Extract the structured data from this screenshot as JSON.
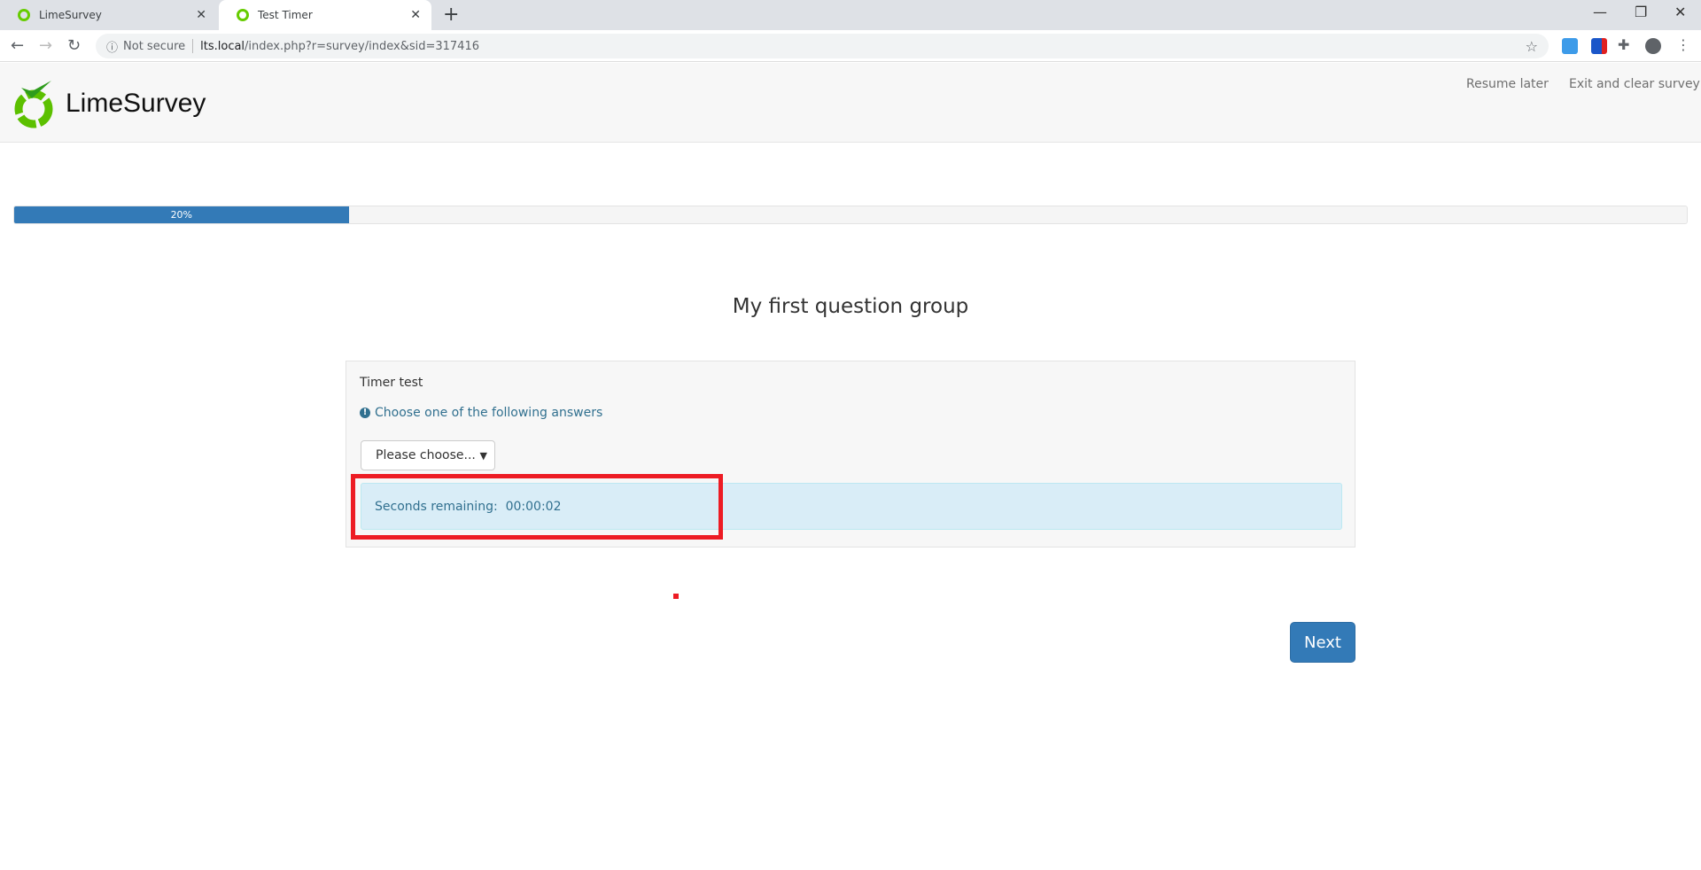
{
  "browser": {
    "tabs": [
      {
        "label": "LimeSurvey",
        "active": false
      },
      {
        "label": "Test Timer",
        "active": true
      }
    ],
    "security": "Not secure",
    "url_host": "lts.local",
    "url_path": "/index.php?r=survey/index&sid=317416"
  },
  "header": {
    "logo_text": "LimeSurvey",
    "resume_later": "Resume later",
    "exit_clear": "Exit and clear survey"
  },
  "progress": {
    "percent": 20,
    "label": "20%"
  },
  "group_title": "My first question group",
  "question": {
    "text": "Timer test",
    "help": "Choose one of the following answers",
    "select_value": "Please choose...",
    "timer_label": "Seconds remaining:",
    "timer_value": "00:00:02"
  },
  "next_label": "Next",
  "colors": {
    "accent": "#337ab7",
    "highlight": "#ed1c24",
    "info_bg": "#d9edf7"
  }
}
